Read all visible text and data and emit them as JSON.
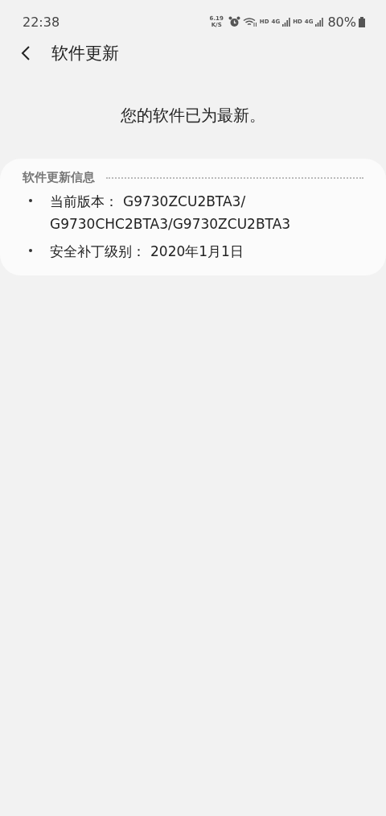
{
  "status_bar": {
    "time": "22:38",
    "speed_value": "6.19",
    "speed_unit": "K/S",
    "network_1": {
      "hd": "HD",
      "type": "4G"
    },
    "network_2": {
      "hd": "HD",
      "type": "4G"
    },
    "battery": "80%"
  },
  "header": {
    "title": "软件更新"
  },
  "message": "您的软件已为最新。",
  "info_card": {
    "title": "软件更新信息",
    "items": [
      {
        "label": "当前版本：",
        "value": "G9730ZCU2BTA3/G9730CHC2BTA3/G9730ZCU2BTA3"
      },
      {
        "label": "安全补丁级别：",
        "value": "2020年1月1日"
      }
    ]
  }
}
